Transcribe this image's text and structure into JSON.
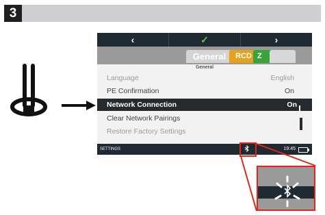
{
  "step": {
    "number": "3"
  },
  "device_screen": {
    "nav": {
      "back": "‹",
      "confirm": "✓",
      "forward": "›"
    },
    "tabs": [
      {
        "label": "General",
        "active": true
      },
      {
        "label": "RCD",
        "active": false
      },
      {
        "label": "Z",
        "active": false
      },
      {
        "label": "",
        "active": false
      }
    ],
    "page_subtitle": "General",
    "rows": [
      {
        "label": "Language",
        "value": "English",
        "state": "dim"
      },
      {
        "label": "PE Confirmation",
        "value": "On",
        "state": "normal"
      },
      {
        "label": "Network Connection",
        "value": "On",
        "state": "selected"
      },
      {
        "label": "Clear Network Pairings",
        "value": "",
        "state": "normal"
      },
      {
        "label": "Restore Factory Settings",
        "value": "",
        "state": "dim"
      }
    ],
    "status_bar": {
      "label": "SETTINGS",
      "bluetooth": "bluetooth-icon",
      "time": "19:45",
      "battery": "battery-icon"
    }
  },
  "zoom_inset": {
    "icon": "bluetooth-blinking-icon"
  },
  "colors": {
    "highlight": "#e3241b",
    "accent_rcd": "#e6a21a",
    "accent_z": "#3aa238",
    "nav": "#1f2a33"
  }
}
